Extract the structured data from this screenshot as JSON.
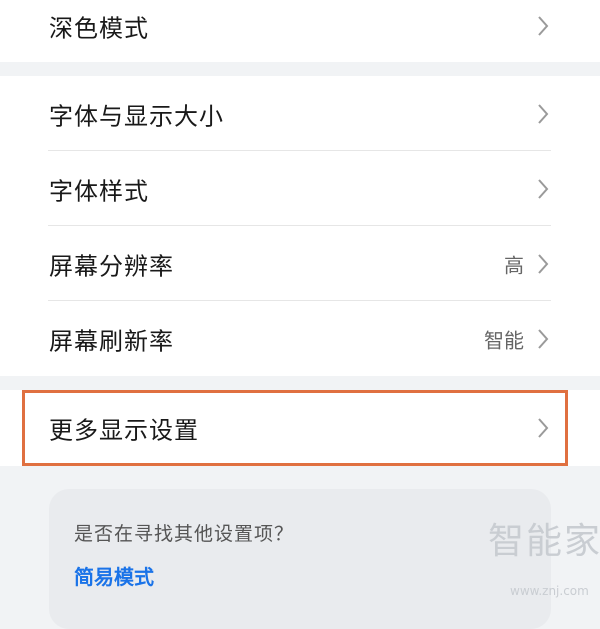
{
  "settings_group_1": {
    "items": [
      {
        "label": "深色模式",
        "value": ""
      }
    ]
  },
  "settings_group_2": {
    "items": [
      {
        "label": "字体与显示大小",
        "value": ""
      },
      {
        "label": "字体样式",
        "value": ""
      },
      {
        "label": "屏幕分辨率",
        "value": "高"
      },
      {
        "label": "屏幕刷新率",
        "value": "智能"
      }
    ]
  },
  "settings_group_3": {
    "items": [
      {
        "label": "更多显示设置",
        "value": ""
      }
    ]
  },
  "suggestions": {
    "title": "是否在寻找其他设置项？",
    "links": [
      "简易模式"
    ]
  },
  "watermark": {
    "text": "智能家",
    "url": "www.znj.com"
  },
  "colors": {
    "highlight_border": "#e07040",
    "link": "#1a73e8",
    "page_background": "#f1f3f5"
  },
  "icons": {
    "row_chevron": "chevron-right-icon"
  }
}
